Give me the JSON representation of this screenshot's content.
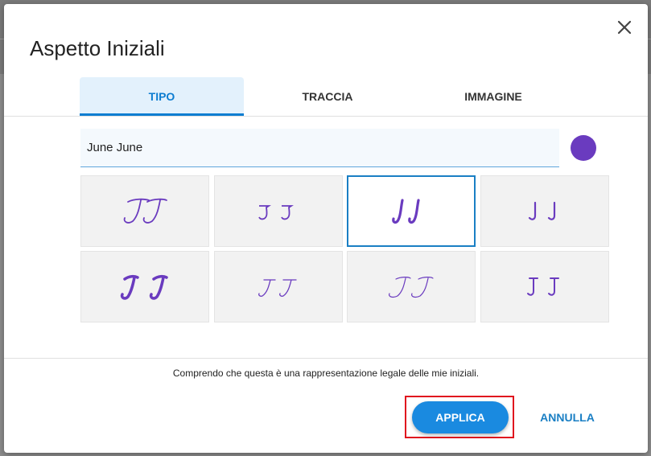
{
  "dialog": {
    "title": "Aspetto Iniziali",
    "close_icon": "close-icon"
  },
  "tabs": [
    {
      "label": "TIPO",
      "active": true
    },
    {
      "label": "TRACCIA",
      "active": false
    },
    {
      "label": "IMMAGINE",
      "active": false
    }
  ],
  "name_field": {
    "value": "June June"
  },
  "color": {
    "selected": "#6a3bbf"
  },
  "styles": [
    {
      "text": "JJ",
      "selected": false
    },
    {
      "text": "J J",
      "selected": false
    },
    {
      "text": "JJ",
      "selected": true
    },
    {
      "text": "J J",
      "selected": false
    },
    {
      "text": "J J",
      "selected": false
    },
    {
      "text": "JJ",
      "selected": false
    },
    {
      "text": "JJ",
      "selected": false
    },
    {
      "text": "J J",
      "selected": false
    }
  ],
  "legal_text": "Comprendo che questa è una rappresentazione legale delle mie iniziali.",
  "buttons": {
    "apply": "APPLICA",
    "cancel": "ANNULLA"
  },
  "colors": {
    "accent": "#1a8ae0",
    "highlight": "#e0141e",
    "ink": "#6a3bbf"
  }
}
